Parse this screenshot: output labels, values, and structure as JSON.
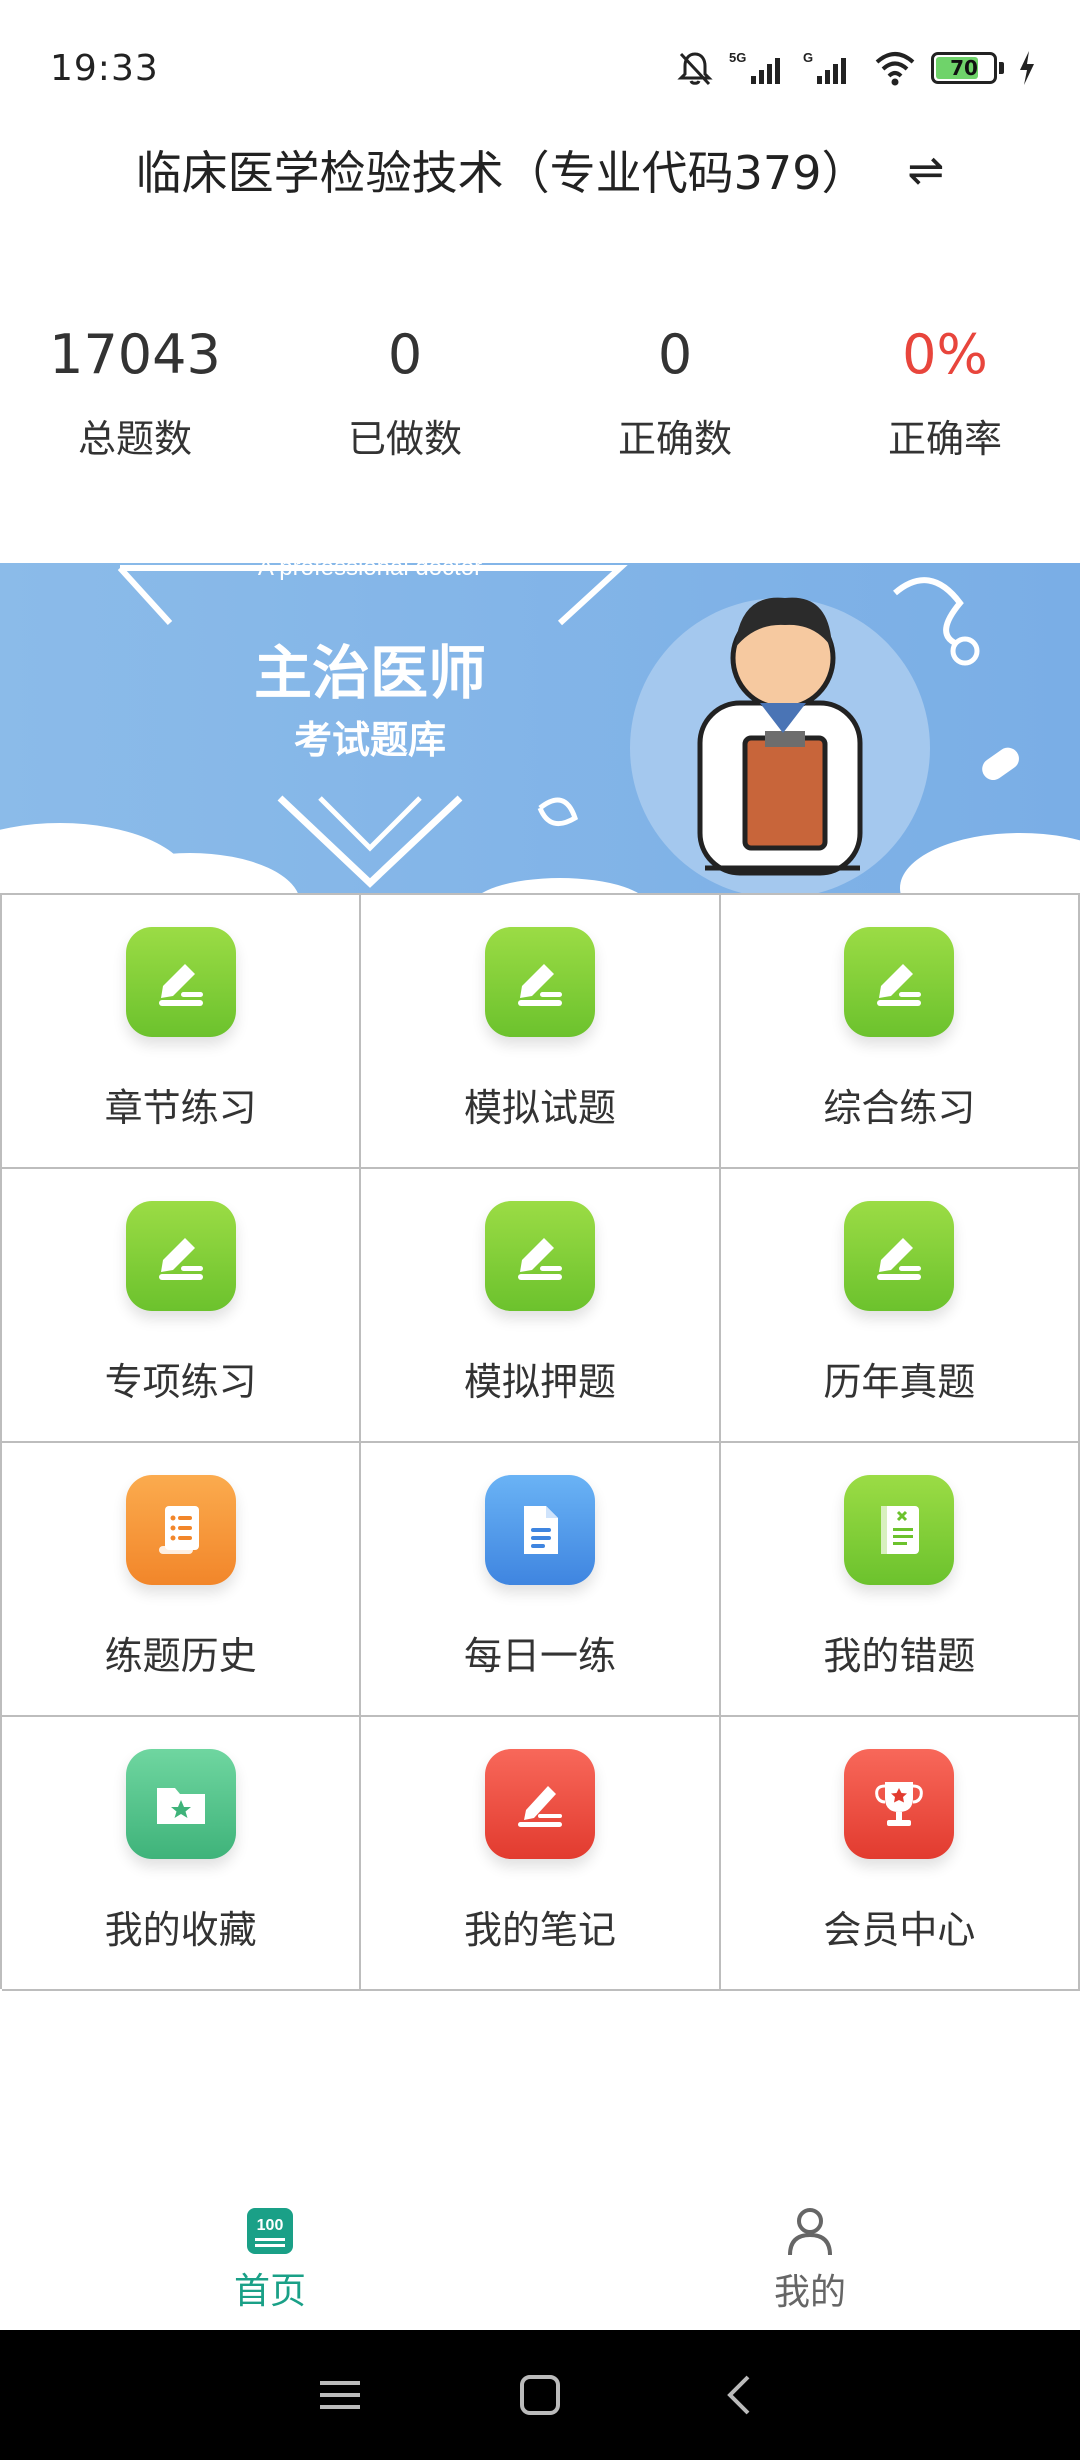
{
  "status_bar": {
    "time": "19:33",
    "battery": "70",
    "signal_1": "5G",
    "signal_2": "G"
  },
  "header": {
    "title": "临床医学检验技术（专业代码379）",
    "switch_icon": "swap-arrows-icon"
  },
  "stats": [
    {
      "value": "17043",
      "label": "总题数"
    },
    {
      "value": "0",
      "label": "已做数"
    },
    {
      "value": "0",
      "label": "正确数"
    },
    {
      "value": "0%",
      "label": "正确率"
    }
  ],
  "banner": {
    "tagline": "A professional doctor",
    "title": "主治医师",
    "subtitle": "考试题库"
  },
  "menu": [
    {
      "label": "章节练习",
      "icon": "pencil-edit-icon",
      "color": "#7fcf3a"
    },
    {
      "label": "模拟试题",
      "icon": "pencil-edit-icon",
      "color": "#7fcf3a"
    },
    {
      "label": "综合练习",
      "icon": "pencil-edit-icon",
      "color": "#7fcf3a"
    },
    {
      "label": "专项练习",
      "icon": "pencil-edit-icon",
      "color": "#7fcf3a"
    },
    {
      "label": "模拟押题",
      "icon": "pencil-edit-icon",
      "color": "#7fcf3a"
    },
    {
      "label": "历年真题",
      "icon": "pencil-edit-icon",
      "color": "#7fcf3a"
    },
    {
      "label": "练题历史",
      "icon": "scroll-list-icon",
      "color": "#f5952f"
    },
    {
      "label": "每日一练",
      "icon": "document-icon",
      "color": "#4a90e2"
    },
    {
      "label": "我的错题",
      "icon": "wrong-book-icon",
      "color": "#7fcf3a"
    },
    {
      "label": "我的收藏",
      "icon": "star-folder-icon",
      "color": "#4cc48a"
    },
    {
      "label": "我的笔记",
      "icon": "note-pen-icon",
      "color": "#ef4a3b"
    },
    {
      "label": "会员中心",
      "icon": "trophy-icon",
      "color": "#ef4a3b"
    }
  ],
  "tabs": [
    {
      "label": "首页",
      "icon": "score-100-icon",
      "active": true
    },
    {
      "label": "我的",
      "icon": "user-icon",
      "active": false
    }
  ],
  "colors": {
    "accent": "#1aa087",
    "rate": "#e8453c",
    "banner_bg": "#7fb2e8"
  }
}
